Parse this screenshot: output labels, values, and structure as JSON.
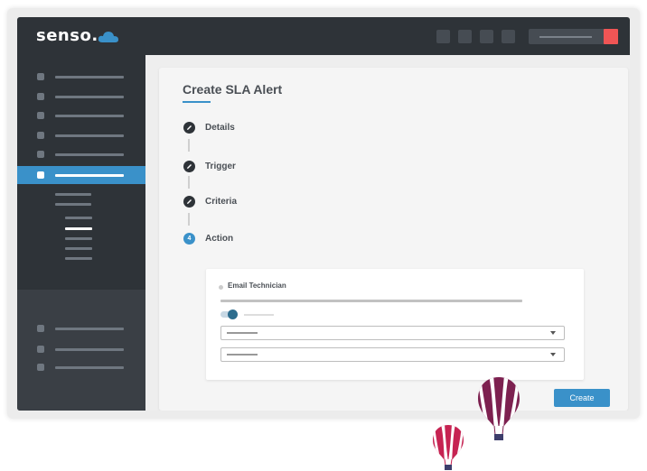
{
  "app": {
    "logo_text": "senso.",
    "logo_icon": "cloud-icon",
    "brand_color": "#3a91c9"
  },
  "page": {
    "title": "Create SLA Alert"
  },
  "steps": [
    {
      "label": "Details",
      "icon": "pencil-icon",
      "state": "done"
    },
    {
      "label": "Trigger",
      "icon": "pencil-icon",
      "state": "done"
    },
    {
      "label": "Criteria",
      "icon": "pencil-icon",
      "state": "done"
    },
    {
      "label": "Action",
      "number": "4",
      "state": "current"
    }
  ],
  "action": {
    "label": "Email Technician"
  },
  "buttons": {
    "create_label": "Create"
  },
  "colors": {
    "sidebar_bg": "#2e3338",
    "accent": "#3a91c9",
    "alert_red": "#f05555"
  }
}
